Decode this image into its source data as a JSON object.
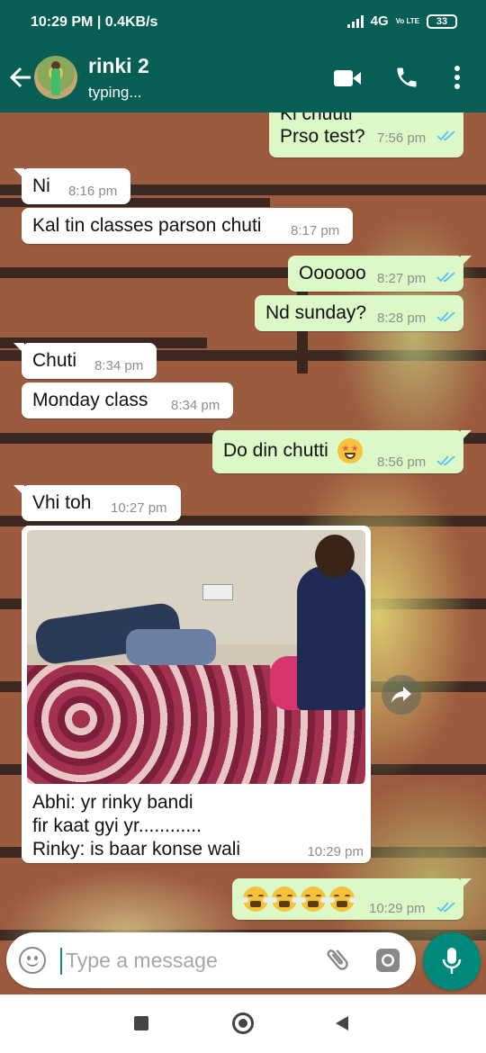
{
  "status_bar": {
    "time_speed": "10:29 PM | 0.4KB/s",
    "network": "4G",
    "volte": "Vo LTE",
    "battery": "33"
  },
  "header": {
    "contact_name": "rinki 2",
    "status": "typing..."
  },
  "messages": [
    {
      "side": "out",
      "text_line1": "Ki chuuti",
      "text_line2": "Prso test?",
      "time": "7:56 pm",
      "read": true
    },
    {
      "side": "in",
      "text": "Ni",
      "time": "8:16 pm"
    },
    {
      "side": "in",
      "text": "Kal tin classes parson chuti",
      "time": "8:17 pm"
    },
    {
      "side": "out",
      "text": "Oooooo",
      "time": "8:27 pm",
      "read": true
    },
    {
      "side": "out",
      "text": "Nd sunday?",
      "time": "8:28 pm",
      "read": true
    },
    {
      "side": "in",
      "text": "Chuti",
      "time": "8:34 pm"
    },
    {
      "side": "in",
      "text": "Monday class",
      "time": "8:34 pm"
    },
    {
      "side": "out",
      "text": "Do din chutti",
      "emoji": "star-struck-emoji",
      "time": "8:56 pm",
      "read": true
    },
    {
      "side": "in",
      "text": "Vhi toh",
      "time": "10:27 pm"
    },
    {
      "side": "in",
      "type": "image",
      "caption_lines": [
        "Abhi: yr rinky bandi",
        "fir kaat gyi yr............",
        "Rinky: is baar konse wali"
      ],
      "time": "10:29 pm"
    },
    {
      "side": "out",
      "emojis": [
        "steam-face-emoji",
        "steam-face-emoji",
        "steam-face-emoji",
        "steam-face-emoji"
      ],
      "time": "10:29 pm",
      "read": true
    }
  ],
  "input": {
    "placeholder": "Type a message"
  },
  "colors": {
    "header": "#075e54",
    "outgoing": "#dcf8c6",
    "incoming": "#ffffff",
    "mic": "#00897b",
    "tick_read": "#4fc3f7"
  }
}
